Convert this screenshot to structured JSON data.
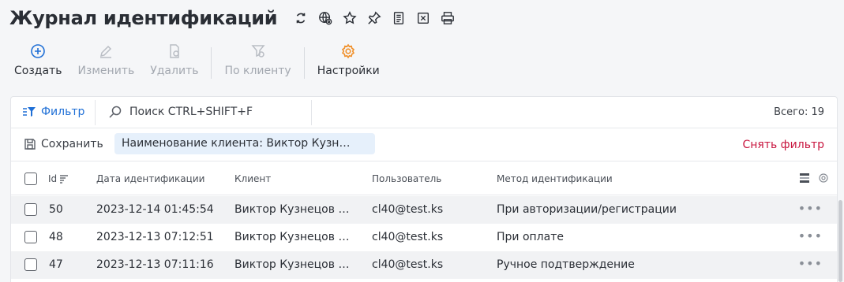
{
  "header": {
    "title": "Журнал идентификаций",
    "icons": [
      "refresh-icon",
      "globe-settings-icon",
      "star-icon",
      "pin-icon",
      "document-icon",
      "excel-icon",
      "print-icon"
    ]
  },
  "toolbar": {
    "create": "Создать",
    "edit": "Изменить",
    "delete": "Удалить",
    "by_client": "По клиенту",
    "settings": "Настройки"
  },
  "filter_bar": {
    "filter_label": "Фильтр",
    "search_placeholder": "Поиск CTRL+SHIFT+F",
    "total": "Всего: 19"
  },
  "saved_filter": {
    "save_label": "Сохранить",
    "active_filter": "Наименование клиента: Виктор Кузн…",
    "clear_label": "Снять фильтр"
  },
  "table": {
    "columns": {
      "id": "Id",
      "date": "Дата идентификации",
      "client": "Клиент",
      "user": "Пользователь",
      "method": "Метод идентификации"
    },
    "rows": [
      {
        "id": "50",
        "date": "2023-12-14 01:45:54",
        "client": "Виктор Кузнецов …",
        "user": "cl40@test.ks",
        "method": "При авторизации/регистрации"
      },
      {
        "id": "48",
        "date": "2023-12-13 07:12:51",
        "client": "Виктор Кузнецов …",
        "user": "cl40@test.ks",
        "method": "При оплате"
      },
      {
        "id": "47",
        "date": "2023-12-13 07:11:16",
        "client": "Виктор Кузнецов …",
        "user": "cl40@test.ks",
        "method": "Ручное подтверждение"
      }
    ],
    "row_menu": "•••"
  },
  "colors": {
    "accent_blue": "#1f6fd6",
    "settings_orange": "#f0902a",
    "clear_red": "#c8163f",
    "chip_bg": "#e6f0fb"
  }
}
